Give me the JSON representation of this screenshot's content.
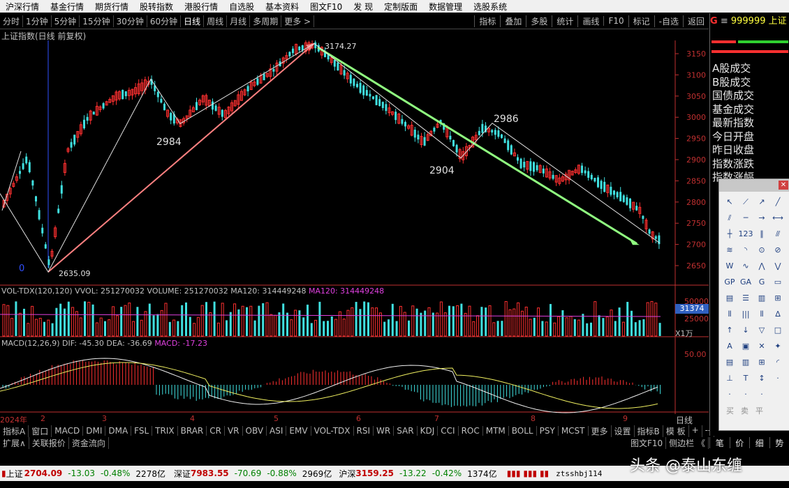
{
  "menu": [
    "沪深行情",
    "基金行情",
    "期货行情",
    "股转指数",
    "港股行情",
    "自选股",
    "基本资料",
    "图文F10",
    "发  现",
    "定制版面",
    "数据管理",
    "选股系统"
  ],
  "period_tabs": [
    "分时",
    "1分钟",
    "5分钟",
    "15分钟",
    "30分钟",
    "60分钟",
    "日线",
    "周线",
    "月线",
    "多周期",
    "更多 >"
  ],
  "active_period": "日线",
  "right_tools": [
    "指标",
    "叠加",
    "多股",
    "统计",
    "画线",
    "F10",
    "标记",
    "-自选",
    "返回"
  ],
  "chart_title": "上证指数(日线 前复权)",
  "price_axis": [
    "3150",
    "3100",
    "3050",
    "3000",
    "2950",
    "2900",
    "2850",
    "2800",
    "2750",
    "2700",
    "2650"
  ],
  "annotations": {
    "peak": "3174.27",
    "low": "2635.09",
    "a": "2984",
    "b": "2904",
    "c": "2986",
    "zero": "0"
  },
  "vol_title": "VOL-TDX(120,120)  VVOL: 251270032  VOLUME: 251270032  MA120: 314449248",
  "vol_title_mag": "MA120: 314449248",
  "vol_axis": [
    "50000",
    "25000"
  ],
  "vol_box": "31374",
  "vol_unit": "X1万",
  "macd_title": "MACD(12,26,9)  DIF: -45.30  DEA: -36.69",
  "macd_title_mag": "MACD: -17.23",
  "macd_axis": [
    "50.00"
  ],
  "dates": [
    "2024年",
    "2",
    "3",
    "4",
    "5",
    "6",
    "7",
    "8",
    "9"
  ],
  "date_right": "日线",
  "indicator_tabs": [
    "指标A",
    "窗口",
    "MACD",
    "DMI",
    "DMA",
    "FSL",
    "TRIX",
    "BRAR",
    "CR",
    "VR",
    "OBV",
    "ASI",
    "EMV",
    "VOL-TDX",
    "RSI",
    "WR",
    "SAR",
    "KDJ",
    "CCI",
    "ROC",
    "MTM",
    "BOLL",
    "PSY",
    "MCST",
    "更多",
    "设置"
  ],
  "indicator_right": [
    "指标B",
    "模 板",
    "+",
    "--"
  ],
  "sub_tabs": [
    "扩展∧",
    "关联报价",
    "资金流向"
  ],
  "sub_right": [
    "图文F10",
    "侧边栏 《"
  ],
  "right_panel": {
    "prefix": "G",
    "code": "999999",
    "name": "上证",
    "rows": [
      "A股成交",
      "B股成交",
      "国债成交",
      "基金成交",
      "最新指数",
      "今日开盘",
      "昨日收盘",
      "指数涨跌",
      "指数涨幅"
    ],
    "bottom_tabs": [
      "笔",
      "价",
      "细",
      "势"
    ]
  },
  "toolbox_icons": [
    "cursor-icon",
    "line-segment-icon",
    "ray-icon",
    "line-icon",
    "parallel-icon",
    "horizontal-line-icon",
    "horizontal-ray-icon",
    "horizontal-segment-icon",
    "vertical-line-icon",
    "price-label-icon",
    "parallel-channel-icon",
    "channel-icon",
    "ray-channel-icon",
    "arc-icon",
    "circle-icon",
    "fibonacci-circle-icon",
    "wave-w-icon",
    "wave-m-icon",
    "zigzag-icon",
    "polyline-icon",
    "fibonacci-icon",
    "gann-icon",
    "gann-angle-icon",
    "gann-fan-icon",
    "period-icon",
    "rectangle-icon",
    "box-icon",
    "bar-icon",
    "time-zone-icon",
    "cycle-icon",
    "ratio-icon",
    "text-icon",
    "up-arrow-icon",
    "down-arrow-icon",
    "triangle-icon",
    "square-icon",
    "buy-icon",
    "sell-icon",
    "flag-icon",
    "text-a-icon",
    "text-label-icon",
    "gray-box-icon",
    "delete-icon",
    "magic-icon",
    "note-icon",
    "memo-icon",
    "screen-icon",
    "curve-icon",
    "up-mark-icon",
    "t-mark-icon",
    "up-down-icon"
  ],
  "toolbox_labels": [
    "买",
    "卖",
    "平"
  ],
  "statusbar": {
    "sh_name": "上证",
    "sh_value": "2704.09",
    "sh_change": "-13.03",
    "sh_pct": "-0.48%",
    "sh_amount": "2278亿",
    "sz_name": "深证",
    "sz_value": "7983.55",
    "sz_change": "-70.69",
    "sz_pct": "-0.88%",
    "sz_amount": "2969亿",
    "hs_name": "沪深",
    "hs_value": "3159.25",
    "hs_change": "-13.22",
    "hs_pct": "-0.42%",
    "hs_amount": "1374亿",
    "user": "ztsshbj114"
  },
  "watermark": "头条 @泰山东缠",
  "colors": {
    "up": "#ff3030",
    "down": "#40e0e0",
    "trend_line": "#90ff80",
    "pink_line": "#ff8080",
    "axis": "#c03030"
  }
}
